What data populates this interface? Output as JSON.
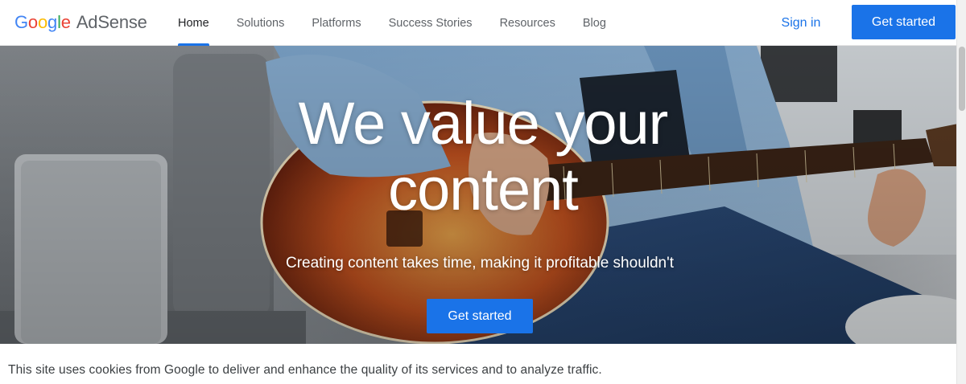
{
  "header": {
    "logo": {
      "brand_letters": [
        {
          "char": "G",
          "color": "#4285f4"
        },
        {
          "char": "o",
          "color": "#ea4335"
        },
        {
          "char": "o",
          "color": "#fbbc05"
        },
        {
          "char": "g",
          "color": "#4285f4"
        },
        {
          "char": "l",
          "color": "#34a853"
        },
        {
          "char": "e",
          "color": "#ea4335"
        }
      ],
      "product": "AdSense"
    },
    "nav": [
      {
        "label": "Home",
        "active": true
      },
      {
        "label": "Solutions",
        "active": false
      },
      {
        "label": "Platforms",
        "active": false
      },
      {
        "label": "Success Stories",
        "active": false
      },
      {
        "label": "Resources",
        "active": false
      },
      {
        "label": "Blog",
        "active": false
      }
    ],
    "sign_in": "Sign in",
    "cta": "Get started"
  },
  "hero": {
    "title_line1": "We value your",
    "title_line2": "content",
    "subtitle": "Creating content takes time, making it profitable shouldn't",
    "cta": "Get started"
  },
  "cookie_notice": "This site uses cookies from Google to deliver and enhance the quality of its services and to analyze traffic.",
  "colors": {
    "accent": "#1a73e8",
    "text_primary": "#202124",
    "text_secondary": "#5f6368"
  }
}
